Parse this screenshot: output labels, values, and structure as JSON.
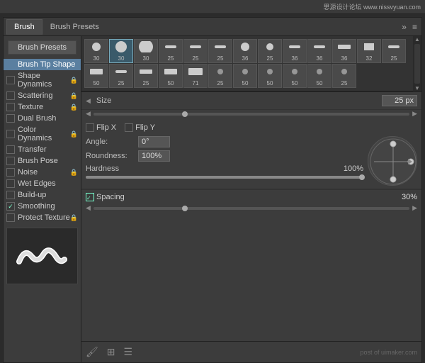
{
  "topbar": {
    "site": "思源设计论坛  www.nissvyuan.com",
    "post_of": "post of uimaker.com"
  },
  "tabs": {
    "brush_label": "Brush",
    "brush_presets_label": "Brush Presets"
  },
  "icons": {
    "forward": "»",
    "menu": "≡",
    "new": "🗋",
    "delete": "🗑",
    "settings": "⚙"
  },
  "brush_presets_btn": "Brush Presets",
  "sidebar_items": [
    {
      "id": "brush-tip-shape",
      "label": "Brush Tip Shape",
      "checkbox": false,
      "lock": false,
      "active": true
    },
    {
      "id": "shape-dynamics",
      "label": "Shape Dynamics",
      "checkbox": true,
      "checked": false,
      "lock": true
    },
    {
      "id": "scattering",
      "label": "Scattering",
      "checkbox": true,
      "checked": false,
      "lock": true
    },
    {
      "id": "texture",
      "label": "Texture",
      "checkbox": true,
      "checked": false,
      "lock": true
    },
    {
      "id": "dual-brush",
      "label": "Dual Brush",
      "checkbox": true,
      "checked": false,
      "lock": false
    },
    {
      "id": "color-dynamics",
      "label": "Color Dynamics",
      "checkbox": true,
      "checked": false,
      "lock": true
    },
    {
      "id": "transfer",
      "label": "Transfer",
      "checkbox": true,
      "checked": false,
      "lock": false
    },
    {
      "id": "brush-pose",
      "label": "Brush Pose",
      "checkbox": true,
      "checked": false,
      "lock": false
    },
    {
      "id": "noise",
      "label": "Noise",
      "checkbox": true,
      "checked": false,
      "lock": true
    },
    {
      "id": "wet-edges",
      "label": "Wet Edges",
      "checkbox": true,
      "checked": false,
      "lock": false
    },
    {
      "id": "build-up",
      "label": "Build-up",
      "checkbox": true,
      "checked": false,
      "lock": false
    },
    {
      "id": "smoothing",
      "label": "Smoothing",
      "checkbox": true,
      "checked": true,
      "lock": false
    },
    {
      "id": "protect-texture",
      "label": "Protect Texture",
      "checkbox": true,
      "checked": false,
      "lock": true
    }
  ],
  "brush_grid": {
    "rows": [
      [
        {
          "size": 6,
          "num": "30",
          "selected": false,
          "shape": "circle"
        },
        {
          "size": 8,
          "num": "30",
          "selected": true,
          "shape": "circle"
        },
        {
          "size": 10,
          "num": "30",
          "selected": false,
          "shape": "circle"
        },
        {
          "size": 6,
          "num": "25",
          "selected": false,
          "shape": "dash"
        },
        {
          "size": 6,
          "num": "25",
          "selected": false,
          "shape": "dash"
        },
        {
          "size": 5,
          "num": "25",
          "selected": false,
          "shape": "dash"
        }
      ],
      [
        {
          "size": 7,
          "num": "36",
          "selected": false,
          "shape": "circle-sm"
        },
        {
          "size": 6,
          "num": "25",
          "selected": false,
          "shape": "circle-sm"
        },
        {
          "size": 7,
          "num": "36",
          "selected": false,
          "shape": "dash"
        },
        {
          "size": 8,
          "num": "36",
          "selected": false,
          "shape": "dash"
        },
        {
          "size": 8,
          "num": "36",
          "selected": false,
          "shape": "dash-w"
        },
        {
          "size": 6,
          "num": "32",
          "selected": false,
          "shape": "rect"
        }
      ],
      [
        {
          "size": 5,
          "num": "25",
          "selected": false,
          "shape": "dash"
        },
        {
          "size": 10,
          "num": "50",
          "selected": false,
          "shape": "dash-lg"
        },
        {
          "size": 5,
          "num": "25",
          "selected": false,
          "shape": "dash"
        },
        {
          "size": 10,
          "num": "25",
          "selected": false,
          "shape": "dash-w"
        },
        {
          "size": 10,
          "num": "50",
          "selected": false,
          "shape": "dash-lg"
        },
        {
          "size": 10,
          "num": "71",
          "selected": false,
          "shape": "dash-xl"
        }
      ],
      [
        {
          "size": 6,
          "num": "25",
          "selected": false,
          "shape": "dot"
        },
        {
          "size": 6,
          "num": "50",
          "selected": false,
          "shape": "dot"
        },
        {
          "size": 7,
          "num": "50",
          "selected": false,
          "shape": "dot"
        },
        {
          "size": 7,
          "num": "50",
          "selected": false,
          "shape": "dot"
        },
        {
          "size": 8,
          "num": "50",
          "selected": false,
          "shape": "dot"
        },
        {
          "size": 6,
          "num": "25",
          "selected": false,
          "shape": "dot"
        }
      ]
    ]
  },
  "size": {
    "label": "Size",
    "value": "25 px",
    "slider_pct": 30
  },
  "flip": {
    "flip_x_label": "Flip X",
    "flip_y_label": "Flip Y"
  },
  "angle": {
    "label": "Angle:",
    "value": "0°"
  },
  "roundness": {
    "label": "Roundness:",
    "value": "100%"
  },
  "hardness": {
    "label": "Hardness",
    "value": "100%"
  },
  "spacing": {
    "label": "Spacing",
    "value": "30%",
    "checked": true
  },
  "bottom_icons": [
    "paint-icon",
    "grid-icon",
    "menu-icon"
  ]
}
